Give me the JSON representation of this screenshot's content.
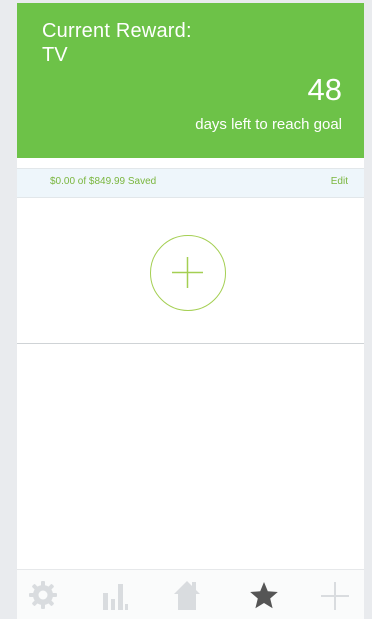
{
  "reward": {
    "title": "Current Reward:",
    "name": "TV",
    "days_left": "48",
    "days_caption": "days left to reach goal"
  },
  "savings": {
    "summary": "$0.00 of $849.99 Saved",
    "edit_label": "Edit"
  },
  "add_button": {
    "icon": "plus-icon"
  },
  "tabbar": {
    "items": [
      {
        "icon": "gear-icon",
        "active": false
      },
      {
        "icon": "bar-chart-icon",
        "active": false
      },
      {
        "icon": "home-icon",
        "active": false
      },
      {
        "icon": "star-icon",
        "active": true
      },
      {
        "icon": "plus-icon",
        "active": false
      }
    ]
  },
  "colors": {
    "accent_green": "#6dc248",
    "text_green": "#7ab63e",
    "circle_green": "#a4cf52",
    "active_tab": "#555555",
    "inactive_tab": "#d9dcdf"
  }
}
